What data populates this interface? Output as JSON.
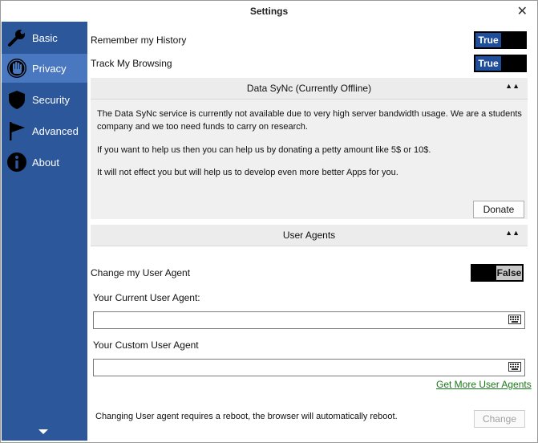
{
  "window": {
    "title": "Settings",
    "close_glyph": "✕"
  },
  "sidebar": {
    "items": [
      {
        "label": "Basic",
        "icon": "wrench-icon"
      },
      {
        "label": "Privacy",
        "icon": "hand-stop-icon",
        "active": true
      },
      {
        "label": "Security",
        "icon": "shield-icon"
      },
      {
        "label": "Advanced",
        "icon": "flag-icon"
      },
      {
        "label": "About",
        "icon": "info-icon"
      }
    ],
    "scroll_down_icon": "chevron-down-icon"
  },
  "privacy": {
    "remember_history": {
      "label": "Remember my History",
      "value": "True"
    },
    "track_browsing": {
      "label": "Track My Browsing",
      "value": "True"
    }
  },
  "datasync": {
    "title": "Data SyNc (Currently Offline)",
    "collapse_glyph": "▲▲",
    "para1": "The Data SyNc service is currently not available due to very high server bandwidth usage. We are a students company and we too need funds to carry on research.",
    "para2": "If you want to help us then you can help us by donating a petty amount like 5$ or 10$.",
    "para3": "It will not effect you but will help us to develop even more better Apps for you.",
    "donate_label": "Donate"
  },
  "user_agents": {
    "title": "User Agents",
    "collapse_glyph": "▲▲",
    "change_label": "Change my User Agent",
    "change_value": "False",
    "current_label": "Your Current User Agent:",
    "current_value": "",
    "custom_label": "Your Custom User Agent",
    "custom_value": "",
    "get_more_link": "Get More User Agents",
    "reboot_note": "Changing User agent requires a reboot, the browser will automatically reboot.",
    "change_button": "Change"
  }
}
